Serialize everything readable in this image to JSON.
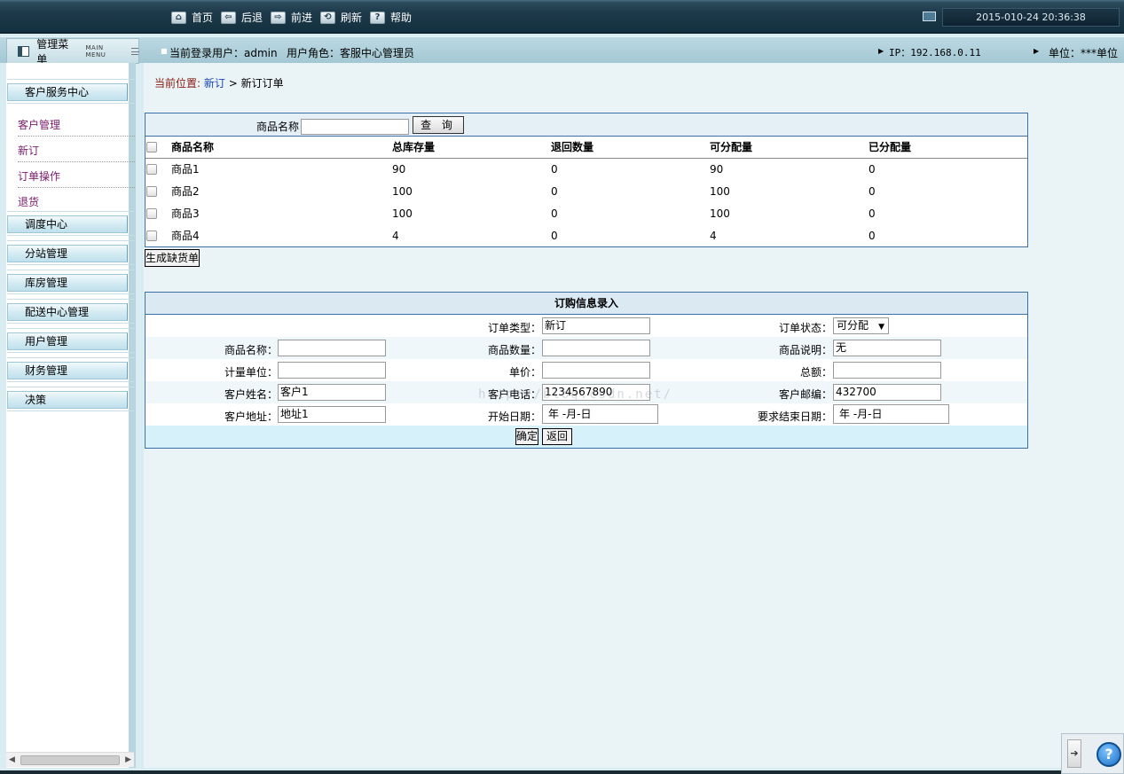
{
  "toolbar": {
    "items": [
      {
        "label": "首页",
        "icon": "home-icon"
      },
      {
        "label": "后退",
        "icon": "back-arrow-icon"
      },
      {
        "label": "前进",
        "icon": "forward-arrow-icon"
      },
      {
        "label": "刷新",
        "icon": "refresh-icon"
      },
      {
        "label": "帮助",
        "icon": "help-icon"
      }
    ],
    "datetime": "2015-010-24 20:36:38"
  },
  "infobar": {
    "menu_label": "管理菜单",
    "menu_sub": "MAIN MENU",
    "login_user": "当前登录用户：admin",
    "user_role": "用户角色：客服中心管理员",
    "ip": "IP：192.168.0.11",
    "unit": "单位：***单位"
  },
  "sidebar": {
    "groups": [
      "客户服务中心",
      "调度中心",
      "分站管理",
      "库房管理",
      "配送中心管理",
      "用户管理",
      "财务管理",
      "决策"
    ],
    "sub_items": [
      "客户管理",
      "新订",
      "订单操作",
      "退货"
    ]
  },
  "breadcrumb": {
    "prefix": "当前位置:",
    "link": "新订",
    "separator": ">",
    "current": "新订订单"
  },
  "search": {
    "label": "商品名称",
    "value": "",
    "button": "查 询"
  },
  "product_table": {
    "headers": [
      "商品名称",
      "总库存量",
      "退回数量",
      "可分配量",
      "已分配量"
    ],
    "rows": [
      [
        "商品1",
        "90",
        "0",
        "90",
        "0"
      ],
      [
        "商品2",
        "100",
        "0",
        "100",
        "0"
      ],
      [
        "商品3",
        "100",
        "0",
        "100",
        "0"
      ],
      [
        "商品4",
        "4",
        "0",
        "4",
        "0"
      ]
    ]
  },
  "generate_button": "生成缺货单",
  "order_form": {
    "title": "订购信息录入",
    "order_type_label": "订单类型：",
    "order_type_value": "新订",
    "order_status_label": "订单状态：",
    "order_status_value": "可分配",
    "product_name_label": "商品名称：",
    "product_name_value": "",
    "product_qty_label": "商品数量：",
    "product_qty_value": "",
    "product_desc_label": "商品说明：",
    "product_desc_value": "无",
    "unit_label": "计量单位：",
    "unit_value": "",
    "price_label": "单价：",
    "price_value": "",
    "total_label": "总额：",
    "total_value": "",
    "customer_name_label": "客户姓名：",
    "customer_name_value": "客户1",
    "customer_phone_label": "客户电话：",
    "customer_phone_value": "1234567890",
    "customer_zip_label": "客户邮编：",
    "customer_zip_value": "432700",
    "customer_addr_label": "客户地址：",
    "customer_addr_value": "地址1",
    "start_date_label": "开始日期：",
    "start_date_value": "年 -月-日",
    "end_date_label": "要求结束日期：",
    "end_date_value": "年 -月-日",
    "confirm_button": "确定",
    "back_button": "返回"
  },
  "watermark": "http://blog.csdn.net/"
}
